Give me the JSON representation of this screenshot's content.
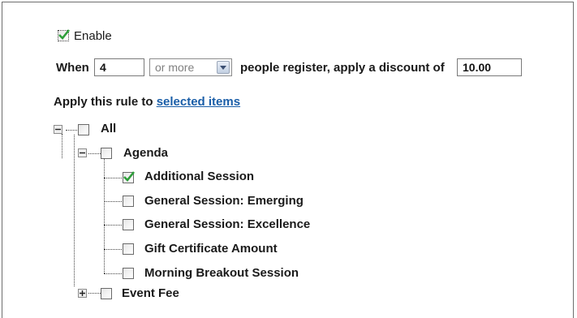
{
  "enable": {
    "label": "Enable",
    "checked": true
  },
  "discount_rule": {
    "prefix": "When",
    "count_value": "4",
    "comparison": "or more",
    "middle": "people register, apply a discount of",
    "discount_value": "10.00"
  },
  "apply": {
    "prefix": "Apply this rule to",
    "link": "selected items"
  },
  "tree": {
    "root": {
      "label": "All",
      "expander": "minus",
      "checked": false
    },
    "agenda": {
      "label": "Agenda",
      "expander": "minus",
      "checked": false,
      "items": [
        {
          "label": "Additional Session",
          "checked": true
        },
        {
          "label": "General Session: Emerging",
          "checked": false
        },
        {
          "label": "General Session: Excellence",
          "checked": false
        },
        {
          "label": "Gift Certificate Amount",
          "checked": false
        },
        {
          "label": "Morning Breakout Session",
          "checked": false
        }
      ]
    },
    "event_fee": {
      "label": "Event Fee",
      "expander": "plus",
      "checked": false
    }
  },
  "colors": {
    "check": "#2e9e3a",
    "link": "#1a5ea8",
    "dropdown_button": "#c3d0e2"
  }
}
